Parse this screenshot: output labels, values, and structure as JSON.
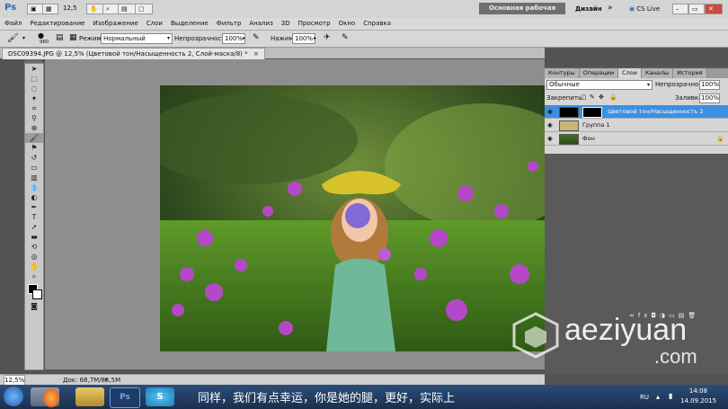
{
  "app": {
    "logo": "Ps",
    "zoom_value": "12,5",
    "workspace_button": "Основная рабочая среда",
    "design_label": "Дизайн",
    "more_label": "»",
    "cslive_label": "CS Live"
  },
  "menu": [
    "Файл",
    "Редактирование",
    "Изображение",
    "Слои",
    "Выделение",
    "Фильтр",
    "Анализ",
    "3D",
    "Просмотр",
    "Окно",
    "Справка"
  ],
  "options": {
    "brush_size": "960",
    "mode_label": "Режим:",
    "mode_value": "Нормальный",
    "opacity_label": "Непрозрачность:",
    "opacity_value": "100%",
    "pressure_label": "Нажим:",
    "pressure_value": "100%"
  },
  "document": {
    "tab_title": "DSC09394.JPG @ 12,5% (Цветовой тон/Насыщенность 2, Слой-маска/8) *",
    "tab_close": "×"
  },
  "status": {
    "zoom": "12,5%",
    "doc_info": "Док: 68,7M/85,5M"
  },
  "layers_panel": {
    "tabs": [
      "Контуры",
      "Операции",
      "Слои",
      "Каналы",
      "История"
    ],
    "active_tab": 2,
    "blend_mode": "Обычные",
    "opacity_label": "Непрозрачность:",
    "opacity_value": "100%",
    "lock_label": "Закрепить:",
    "fill_label": "Заливка:",
    "fill_value": "100%",
    "layers": [
      {
        "name": "Цветовой тон/Насыщенность 2",
        "selected": true
      },
      {
        "name": "Группа 1",
        "selected": false
      },
      {
        "name": "Фон",
        "selected": false
      }
    ]
  },
  "subtitle": "同样，我们有点幸运，你是她的腿，更好，实际上",
  "watermark": {
    "line1": "aeziyuan",
    "line2": ".com"
  },
  "taskbar": {
    "lang": "RU",
    "time": "14:08",
    "date": "14.09.2015"
  },
  "colors": {
    "selected_layer": "#3d8fe0",
    "taskbar": "#1f3a60"
  }
}
